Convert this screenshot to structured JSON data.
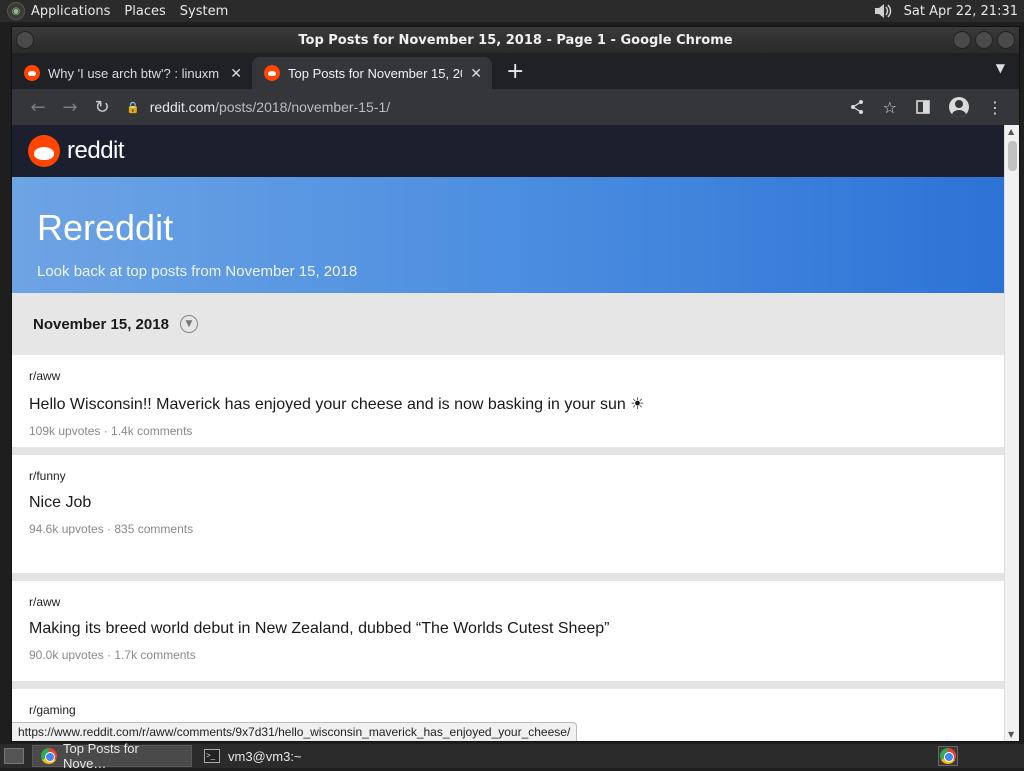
{
  "top_panel": {
    "menus": [
      "Applications",
      "Places",
      "System"
    ],
    "clock": "Sat Apr 22, 21:31"
  },
  "window": {
    "title": "Top Posts for November 15, 2018 - Page 1 - Google Chrome"
  },
  "tabs": [
    {
      "label": "Why 'I use arch btw'? : linuxm",
      "active": false
    },
    {
      "label": "Top Posts for November 15, 20",
      "active": true
    }
  ],
  "toolbar": {
    "url_host": "reddit.com",
    "url_path": "/posts/2018/november-15-1/"
  },
  "page": {
    "brand": "reddit",
    "hero_title": "Rereddit",
    "hero_subtitle": "Look back at top posts from November 15, 2018",
    "date_label": "November 15, 2018",
    "posts": [
      {
        "subreddit": "r/aww",
        "title": "Hello Wisconsin!! Maverick has enjoyed your cheese and is now basking in your sun ☀",
        "meta": "109k upvotes · 1.4k comments"
      },
      {
        "subreddit": "r/funny",
        "title": "Nice Job",
        "meta": "94.6k upvotes · 835 comments"
      },
      {
        "subreddit": "r/aww",
        "title": "Making its breed world debut in New Zealand, dubbed “The Worlds Cutest Sheep”",
        "meta": "90.0k upvotes · 1.7k comments"
      },
      {
        "subreddit": "r/gaming",
        "title": "",
        "meta": ""
      }
    ],
    "status_url": "https://www.reddit.com/r/aww/comments/9x7d31/hello_wisconsin_maverick_has_enjoyed_your_cheese/"
  },
  "taskbar": {
    "items": [
      {
        "label": "Top Posts for Nove…",
        "icon": "chrome-icon",
        "active": true
      },
      {
        "label": "vm3@vm3:~",
        "icon": "terminal-icon",
        "active": false
      }
    ]
  },
  "colors": {
    "reddit_orange": "#ff4500",
    "hero_start": "#6ea4e4",
    "hero_end": "#2d73d6",
    "header_dark": "#1c1f2e"
  }
}
